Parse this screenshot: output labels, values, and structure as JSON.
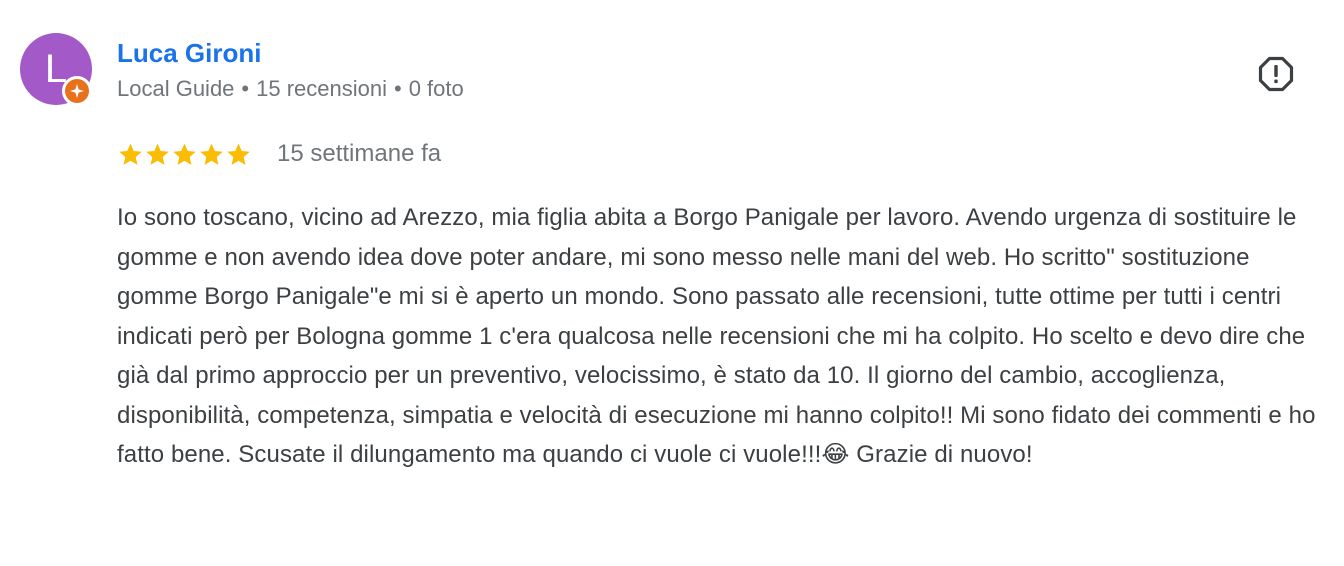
{
  "reviewer": {
    "initial": "L",
    "name": "Luca Gironi",
    "role": "Local Guide",
    "reviews_count": "15 recensioni",
    "photos_count": "0 foto",
    "separator": "•",
    "avatar_color": "#a35ac8",
    "badge_color": "#e8711c",
    "badge_icon": "local-guide-star-icon"
  },
  "review": {
    "rating": 5,
    "max_rating": 5,
    "star_color": "#fbbc04",
    "date": "15 settimane fa",
    "text": "Io sono toscano, vicino ad Arezzo, mia figlia abita a Borgo Panigale per lavoro. Avendo urgenza di sostituire le gomme e non avendo idea dove poter andare, mi sono messo nelle mani del web. Ho scritto\" sostituzione gomme Borgo Panigale\"e mi si è aperto un mondo. Sono passato alle recensioni, tutte ottime per tutti i centri indicati però per Bologna gomme 1 c'era qualcosa nelle recensioni che mi ha colpito. Ho scelto e devo dire che già dal primo approccio per un preventivo, velocissimo, è stato da 10. Il giorno del cambio, accoglienza, disponibilità, competenza, simpatia e velocità di esecuzione mi hanno colpito!! Mi sono fidato dei commenti e ho fatto bene. Scusate il dilungamento ma quando ci vuole ci vuole!!!😂 Grazie di nuovo!"
  },
  "actions": {
    "flag_icon": "report-flag-icon"
  }
}
